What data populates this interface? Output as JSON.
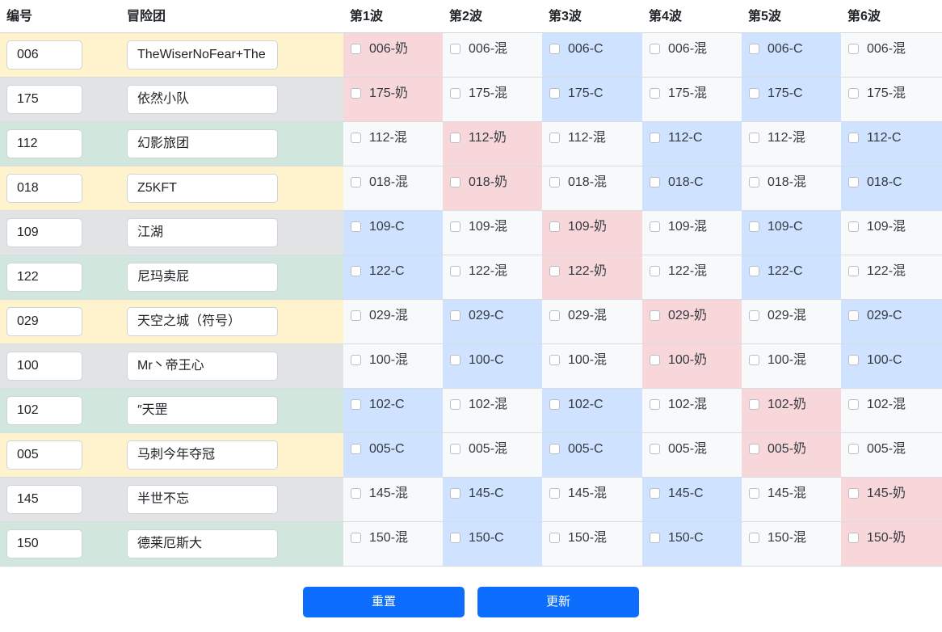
{
  "headers": {
    "id": "编号",
    "team": "冒险团",
    "waves": [
      "第1波",
      "第2波",
      "第3波",
      "第4波",
      "第5波",
      "第6波"
    ]
  },
  "colors": {
    "yellow": "#fff3cd",
    "gray": "#e2e3e5",
    "green": "#d1e7dd",
    "pink": "#f8d7da",
    "blue": "#cfe2ff",
    "light": "#f8f9fa",
    "primary": "#0d6efd"
  },
  "rows": [
    {
      "id": "006",
      "team": "TheWiserNoFear+The",
      "rowColor": "yellow",
      "cells": [
        {
          "label": "006-奶",
          "color": "pink"
        },
        {
          "label": "006-混",
          "color": "light"
        },
        {
          "label": "006-C",
          "color": "blue"
        },
        {
          "label": "006-混",
          "color": "light"
        },
        {
          "label": "006-C",
          "color": "blue"
        },
        {
          "label": "006-混",
          "color": "light"
        }
      ]
    },
    {
      "id": "175",
      "team": "依然小队",
      "rowColor": "gray",
      "cells": [
        {
          "label": "175-奶",
          "color": "pink"
        },
        {
          "label": "175-混",
          "color": "light"
        },
        {
          "label": "175-C",
          "color": "blue"
        },
        {
          "label": "175-混",
          "color": "light"
        },
        {
          "label": "175-C",
          "color": "blue"
        },
        {
          "label": "175-混",
          "color": "light"
        }
      ]
    },
    {
      "id": "112",
      "team": "幻影旅团",
      "rowColor": "green",
      "cells": [
        {
          "label": "112-混",
          "color": "light"
        },
        {
          "label": "112-奶",
          "color": "pink"
        },
        {
          "label": "112-混",
          "color": "light"
        },
        {
          "label": "112-C",
          "color": "blue"
        },
        {
          "label": "112-混",
          "color": "light"
        },
        {
          "label": "112-C",
          "color": "blue"
        }
      ]
    },
    {
      "id": "018",
      "team": "Z5KFT",
      "rowColor": "yellow",
      "cells": [
        {
          "label": "018-混",
          "color": "light"
        },
        {
          "label": "018-奶",
          "color": "pink"
        },
        {
          "label": "018-混",
          "color": "light"
        },
        {
          "label": "018-C",
          "color": "blue"
        },
        {
          "label": "018-混",
          "color": "light"
        },
        {
          "label": "018-C",
          "color": "blue"
        }
      ]
    },
    {
      "id": "109",
      "team": "江湖",
      "rowColor": "gray",
      "cells": [
        {
          "label": "109-C",
          "color": "blue"
        },
        {
          "label": "109-混",
          "color": "light"
        },
        {
          "label": "109-奶",
          "color": "pink"
        },
        {
          "label": "109-混",
          "color": "light"
        },
        {
          "label": "109-C",
          "color": "blue"
        },
        {
          "label": "109-混",
          "color": "light"
        }
      ]
    },
    {
      "id": "122",
      "team": "尼玛卖屁",
      "rowColor": "green",
      "cells": [
        {
          "label": "122-C",
          "color": "blue"
        },
        {
          "label": "122-混",
          "color": "light"
        },
        {
          "label": "122-奶",
          "color": "pink"
        },
        {
          "label": "122-混",
          "color": "light"
        },
        {
          "label": "122-C",
          "color": "blue"
        },
        {
          "label": "122-混",
          "color": "light"
        }
      ]
    },
    {
      "id": "029",
      "team": "天空之城（符号）",
      "rowColor": "yellow",
      "cells": [
        {
          "label": "029-混",
          "color": "light"
        },
        {
          "label": "029-C",
          "color": "blue"
        },
        {
          "label": "029-混",
          "color": "light"
        },
        {
          "label": "029-奶",
          "color": "pink"
        },
        {
          "label": "029-混",
          "color": "light"
        },
        {
          "label": "029-C",
          "color": "blue"
        }
      ]
    },
    {
      "id": "100",
      "team": "Mr丶帝王心",
      "rowColor": "gray",
      "cells": [
        {
          "label": "100-混",
          "color": "light"
        },
        {
          "label": "100-C",
          "color": "blue"
        },
        {
          "label": "100-混",
          "color": "light"
        },
        {
          "label": "100-奶",
          "color": "pink"
        },
        {
          "label": "100-混",
          "color": "light"
        },
        {
          "label": "100-C",
          "color": "blue"
        }
      ]
    },
    {
      "id": "102",
      "team": "″天罡",
      "rowColor": "green",
      "cells": [
        {
          "label": "102-C",
          "color": "blue"
        },
        {
          "label": "102-混",
          "color": "light"
        },
        {
          "label": "102-C",
          "color": "blue"
        },
        {
          "label": "102-混",
          "color": "light"
        },
        {
          "label": "102-奶",
          "color": "pink"
        },
        {
          "label": "102-混",
          "color": "light"
        }
      ]
    },
    {
      "id": "005",
      "team": "马刺今年夺冠",
      "rowColor": "yellow",
      "cells": [
        {
          "label": "005-C",
          "color": "blue"
        },
        {
          "label": "005-混",
          "color": "light"
        },
        {
          "label": "005-C",
          "color": "blue"
        },
        {
          "label": "005-混",
          "color": "light"
        },
        {
          "label": "005-奶",
          "color": "pink"
        },
        {
          "label": "005-混",
          "color": "light"
        }
      ]
    },
    {
      "id": "145",
      "team": "半世不忘",
      "rowColor": "gray",
      "cells": [
        {
          "label": "145-混",
          "color": "light"
        },
        {
          "label": "145-C",
          "color": "blue"
        },
        {
          "label": "145-混",
          "color": "light"
        },
        {
          "label": "145-C",
          "color": "blue"
        },
        {
          "label": "145-混",
          "color": "light"
        },
        {
          "label": "145-奶",
          "color": "pink"
        }
      ]
    },
    {
      "id": "150",
      "team": "德莱厄斯大",
      "rowColor": "green",
      "cells": [
        {
          "label": "150-混",
          "color": "light"
        },
        {
          "label": "150-C",
          "color": "blue"
        },
        {
          "label": "150-混",
          "color": "light"
        },
        {
          "label": "150-C",
          "color": "blue"
        },
        {
          "label": "150-混",
          "color": "light"
        },
        {
          "label": "150-奶",
          "color": "pink"
        }
      ]
    }
  ],
  "buttons": {
    "reset": "重置",
    "update": "更新"
  }
}
